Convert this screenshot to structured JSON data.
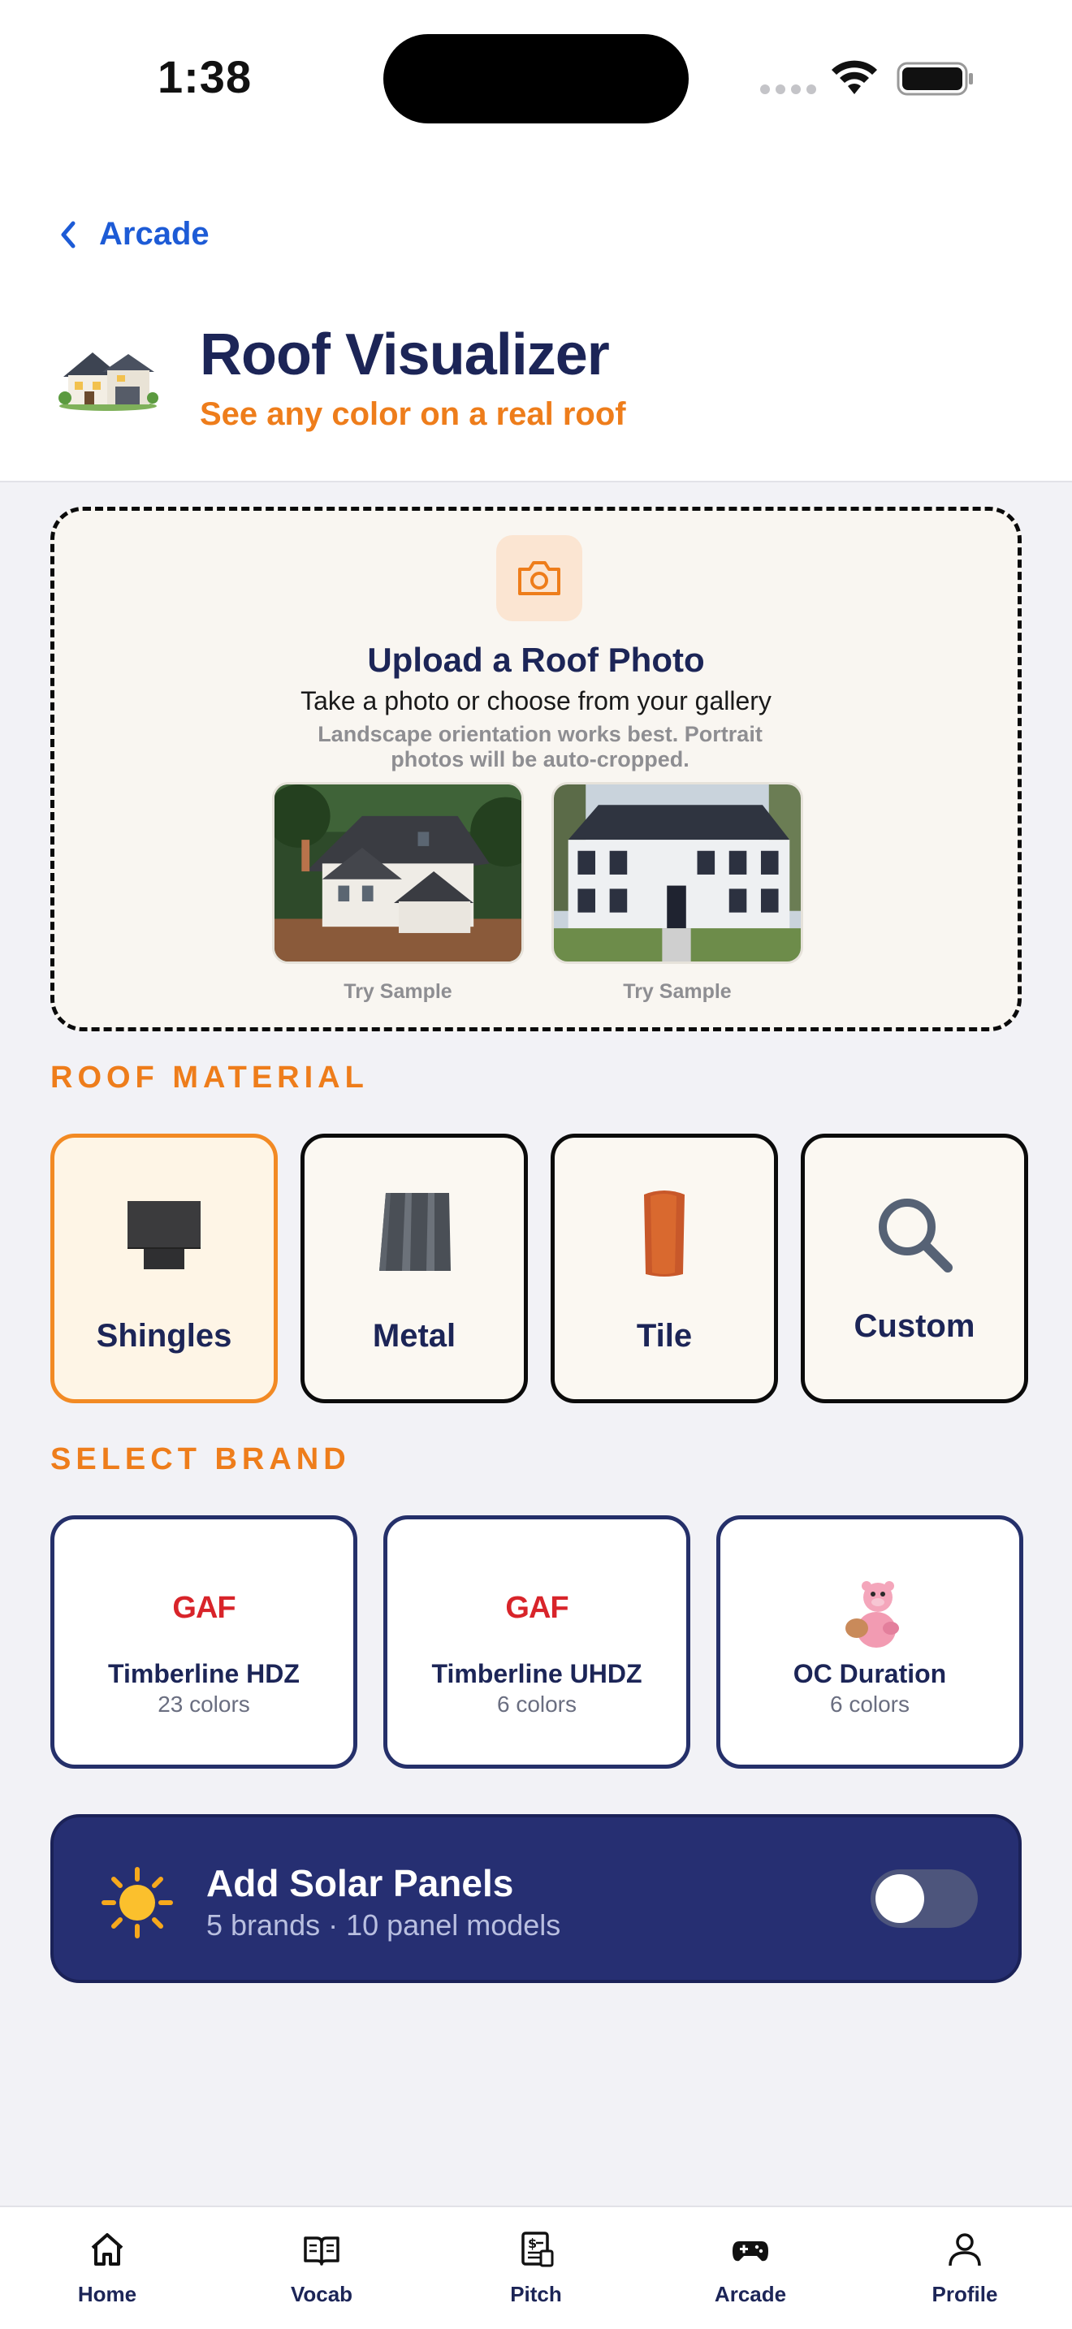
{
  "status_bar": {
    "time": "1:38"
  },
  "nav": {
    "back_label": "Arcade"
  },
  "header": {
    "title": "Roof Visualizer",
    "subtitle": "See any color on a real roof"
  },
  "upload": {
    "title": "Upload a Roof Photo",
    "subtitle": "Take a photo or choose from your gallery",
    "hint": "Landscape orientation works best. Portrait photos will be auto-cropped.",
    "samples": [
      {
        "label": "Try Sample"
      },
      {
        "label": "Try Sample"
      }
    ]
  },
  "material_section": {
    "label": "ROOF MATERIAL",
    "selected": "Shingles",
    "items": [
      {
        "label": "Shingles"
      },
      {
        "label": "Metal"
      },
      {
        "label": "Tile"
      },
      {
        "label": "Custom"
      }
    ]
  },
  "brand_section": {
    "label": "SELECT BRAND",
    "items": [
      {
        "logo": "GAF",
        "name": "Timberline HDZ",
        "count": "23 colors"
      },
      {
        "logo": "GAF",
        "name": "Timberline UHDZ",
        "count": "6 colors"
      },
      {
        "logo": "",
        "name": "OC Duration",
        "count": "6 colors"
      }
    ]
  },
  "solar": {
    "title": "Add Solar Panels",
    "subtitle": "5 brands · 10 panel models",
    "enabled": false
  },
  "tab_bar": {
    "items": [
      {
        "label": "Home",
        "icon": "home-icon"
      },
      {
        "label": "Vocab",
        "icon": "book-icon"
      },
      {
        "label": "Pitch",
        "icon": "document-icon"
      },
      {
        "label": "Arcade",
        "icon": "gamepad-icon"
      },
      {
        "label": "Profile",
        "icon": "person-icon"
      }
    ]
  },
  "colors": {
    "accent": "#ee7d1b",
    "navy": "#1c2557",
    "link": "#1d5bd6",
    "solar_bg": "#262f72"
  }
}
